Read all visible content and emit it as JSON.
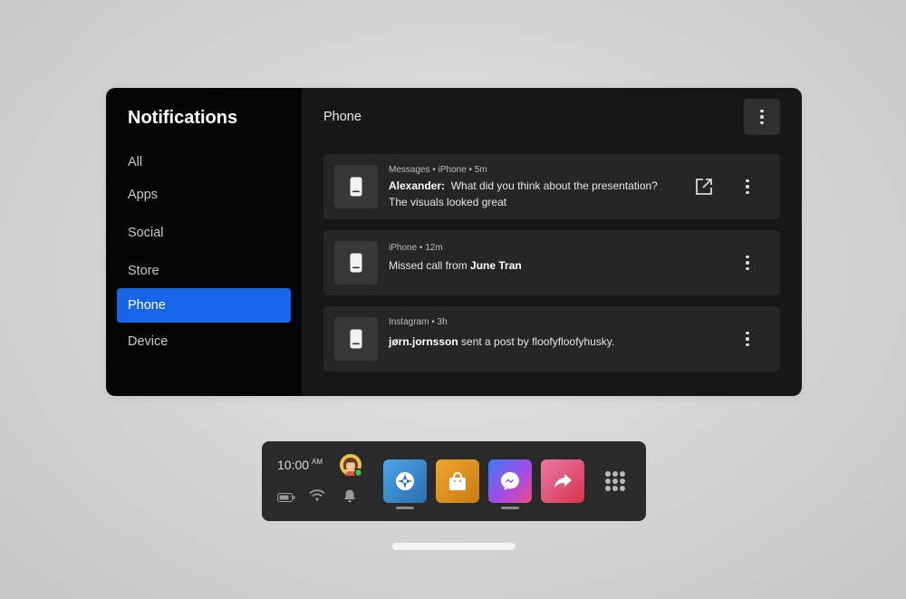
{
  "sidebar": {
    "title": "Notifications",
    "items": [
      {
        "label": "All"
      },
      {
        "label": "Apps"
      },
      {
        "label": "Social"
      },
      {
        "label": "Store"
      },
      {
        "label": "Phone"
      },
      {
        "label": "Device"
      }
    ],
    "active": "Phone"
  },
  "main": {
    "title": "Phone",
    "notifications": [
      {
        "icon": "phone-icon",
        "meta": "Messages • iPhone • 5m",
        "sender": "Alexander:",
        "message": "What did you think about the presentation?",
        "message2": "The visuals looked great",
        "has_open_external": true
      },
      {
        "icon": "phone-icon",
        "meta": "iPhone • 12m",
        "prefix": "Missed call from",
        "bold": "June Tran"
      },
      {
        "icon": "phone-icon",
        "meta": "Instagram • 3h",
        "bold": "jørn.jornsson",
        "suffix": "sent a post by floofyfloofyhusky."
      }
    ]
  },
  "dock": {
    "time": "10:00",
    "ampm": "AM",
    "status_icons": [
      "battery-icon",
      "wifi-icon",
      "bell-icon"
    ],
    "apps": [
      {
        "name": "explore-app",
        "color": "#3a88c8"
      },
      {
        "name": "store-app",
        "color": "#e09a1c"
      },
      {
        "name": "messenger-app",
        "color": "#a64be8"
      },
      {
        "name": "share-app",
        "color": "#e0506a"
      }
    ],
    "grid_icon": "app-library-icon"
  },
  "colors": {
    "accent": "#1766e9",
    "panel": "#171717",
    "sidebar": "#050505",
    "card": "#262626"
  }
}
